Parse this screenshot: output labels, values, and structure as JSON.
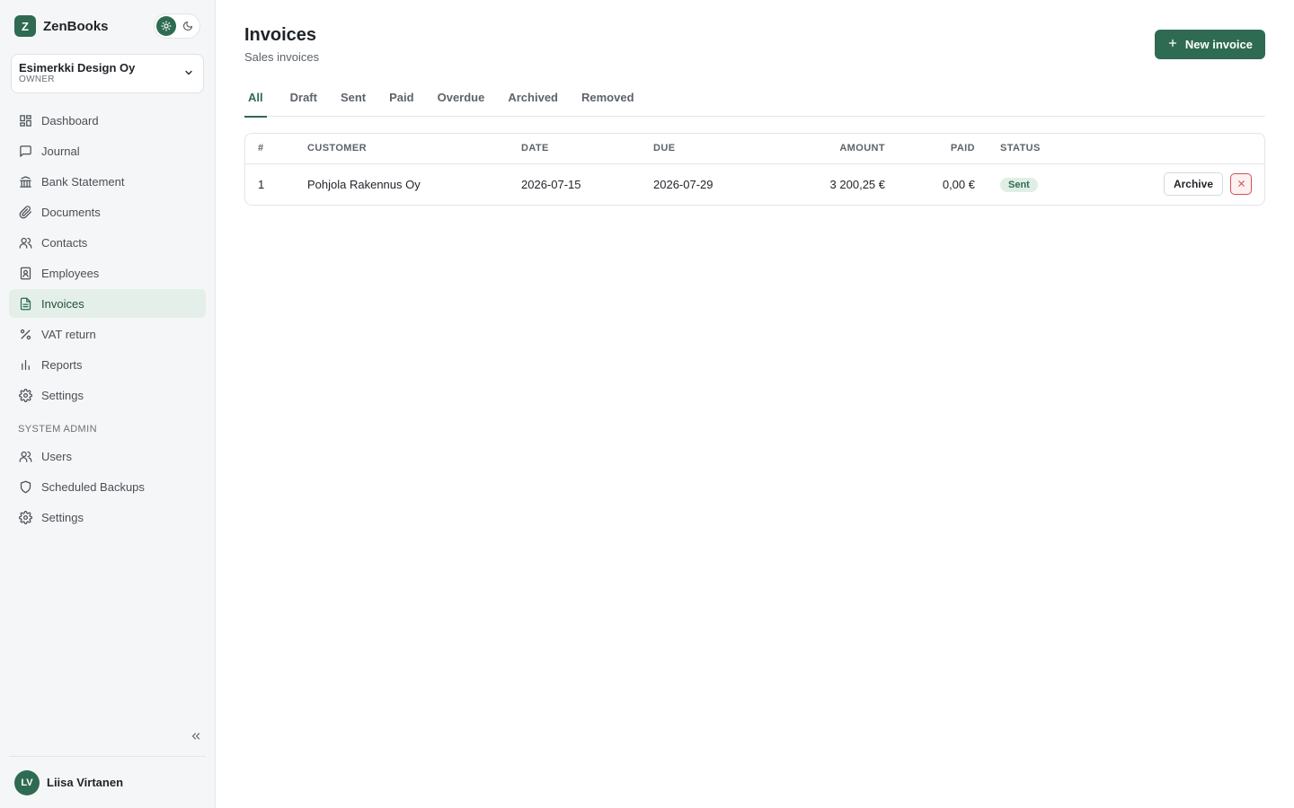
{
  "app": {
    "logo_letter": "Z",
    "name": "ZenBooks"
  },
  "org": {
    "name": "Esimerkki Design Oy",
    "role": "OWNER"
  },
  "nav": {
    "items": [
      {
        "label": "Dashboard",
        "icon": "dashboard-icon"
      },
      {
        "label": "Journal",
        "icon": "journal-icon"
      },
      {
        "label": "Bank Statement",
        "icon": "bank-icon"
      },
      {
        "label": "Documents",
        "icon": "paperclip-icon"
      },
      {
        "label": "Contacts",
        "icon": "users-icon"
      },
      {
        "label": "Employees",
        "icon": "badge-icon"
      },
      {
        "label": "Invoices",
        "icon": "file-icon",
        "active": true
      },
      {
        "label": "VAT return",
        "icon": "percent-icon"
      },
      {
        "label": "Reports",
        "icon": "bar-chart-icon"
      },
      {
        "label": "Settings",
        "icon": "gear-icon"
      }
    ],
    "admin_label": "SYSTEM ADMIN",
    "admin_items": [
      {
        "label": "Users",
        "icon": "users-icon"
      },
      {
        "label": "Scheduled Backups",
        "icon": "shield-icon"
      },
      {
        "label": "Settings",
        "icon": "gear-icon"
      }
    ]
  },
  "user": {
    "initials": "LV",
    "name": "Liisa Virtanen"
  },
  "page": {
    "title": "Invoices",
    "subtitle": "Sales invoices",
    "new_button": "New invoice"
  },
  "tabs": [
    "All",
    "Draft",
    "Sent",
    "Paid",
    "Overdue",
    "Archived",
    "Removed"
  ],
  "table": {
    "headers": {
      "num": "#",
      "customer": "CUSTOMER",
      "date": "DATE",
      "due": "DUE",
      "amount": "AMOUNT",
      "paid": "PAID",
      "status": "STATUS"
    },
    "rows": [
      {
        "num": "1",
        "customer": "Pohjola Rakennus Oy",
        "date": "2026-07-15",
        "due": "2026-07-29",
        "amount": "3 200,25 €",
        "paid": "0,00 €",
        "status": "Sent",
        "archive_label": "Archive"
      }
    ]
  },
  "colors": {
    "accent": "#2e6b52",
    "danger": "#d05252"
  }
}
